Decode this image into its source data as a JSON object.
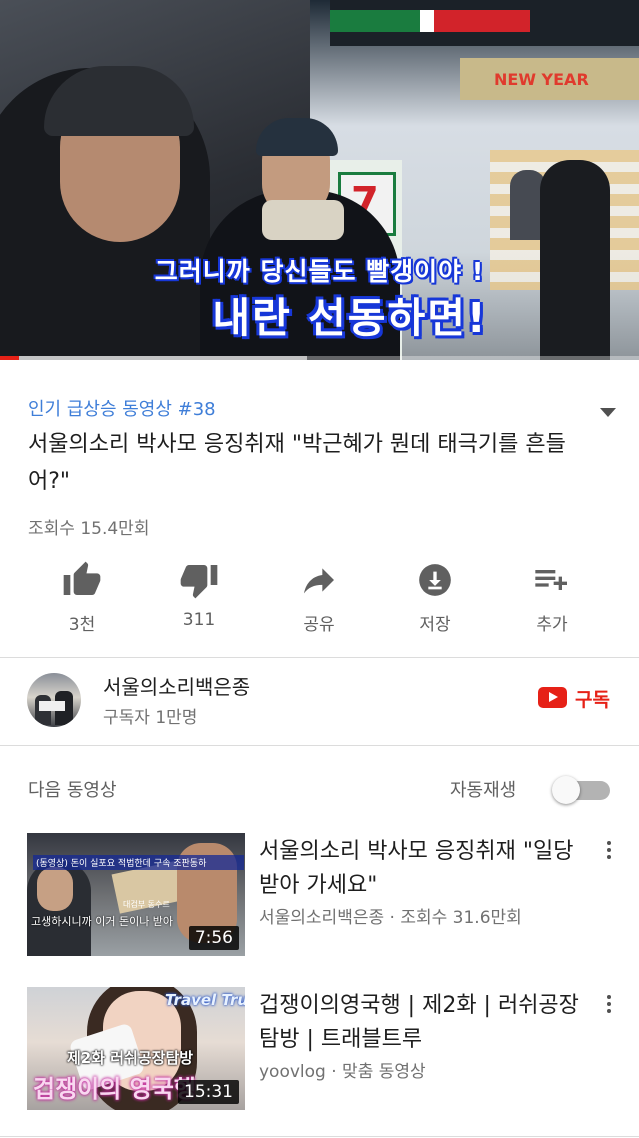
{
  "player": {
    "subtitle_line1": "그러니까 당신들도 빨갱이야 !",
    "subtitle_line2": "내란 선동하면!",
    "progress_fraction": 0.03,
    "buffered_fraction": 0.48
  },
  "video": {
    "trending_label": "인기 급상승 동영상 #38",
    "title": "서울의소리 박사모 응징취재 \"박근혜가 뭔데 태극기를 흔들어?\"",
    "views": "조회수 15.4만회"
  },
  "actions": [
    {
      "icon": "thumbs-up-icon",
      "label": "3천"
    },
    {
      "icon": "thumbs-down-icon",
      "label": "311"
    },
    {
      "icon": "share-icon",
      "label": "공유"
    },
    {
      "icon": "download-icon",
      "label": "저장"
    },
    {
      "icon": "add-to-playlist-icon",
      "label": "추가"
    }
  ],
  "channel": {
    "name": "서울의소리백은종",
    "subscribers": "구독자 1만명",
    "subscribe_label": "구독"
  },
  "up_next": {
    "heading": "다음 동영상",
    "autoplay_label": "자동재생",
    "autoplay_on": false,
    "items": [
      {
        "title": "서울의소리 박사모 응징취재 \"일당 받아 가세요\"",
        "meta": "서울의소리백은종 · 조회수 31.6만회",
        "duration": "7:56",
        "thumb_caption_top": "(동영상) 돈이 실포요 적법한데 구속 조판동하",
        "thumb_caption_bottom": "고생하시니까 이거 돈이나 받아",
        "thumb_caption_small": "대검부 동수르"
      },
      {
        "title": "겁쟁이의영국행 | 제2화 | 러쉬공장탐방 | 트래블트루",
        "meta": "yoovlog · 맞춤 동영상",
        "duration": "15:31",
        "thumb_tag": "Travel True",
        "thumb_sub": "제2화 러쉬공장탐방",
        "thumb_big": "겁쟁이의 영국행"
      }
    ]
  },
  "colors": {
    "accent_red": "#e62117",
    "trending_blue": "#3f7ed8",
    "subtitle_outline": "#1737d8"
  }
}
